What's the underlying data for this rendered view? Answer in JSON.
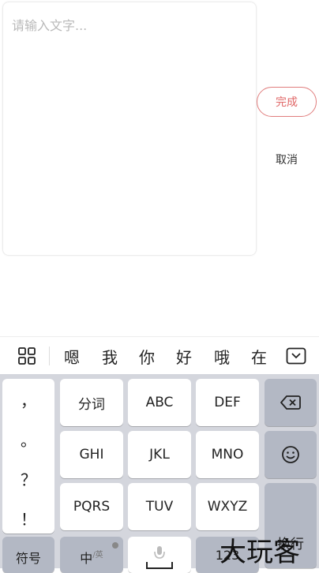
{
  "editor": {
    "placeholder": "请输入文字..."
  },
  "actions": {
    "done": "完成",
    "cancel": "取消"
  },
  "candidates": [
    "嗯",
    "我",
    "你",
    "好",
    "哦",
    "在"
  ],
  "keyboard": {
    "punctuation": [
      "，",
      "。",
      "？",
      "！"
    ],
    "row1": [
      "分词",
      "ABC",
      "DEF"
    ],
    "row2": [
      "GHI",
      "JKL",
      "MNO"
    ],
    "row3": [
      "PQRS",
      "TUV",
      "WXYZ"
    ],
    "bottom": {
      "symbols": "符号",
      "chinese": "中",
      "english_small": "/英",
      "numbers": "123",
      "enter": "换行"
    }
  },
  "watermark": "大玩客",
  "colors": {
    "accent": "#e06767",
    "keyboard_bg": "#d4d6dd",
    "fn_key": "#b3b8c4"
  }
}
